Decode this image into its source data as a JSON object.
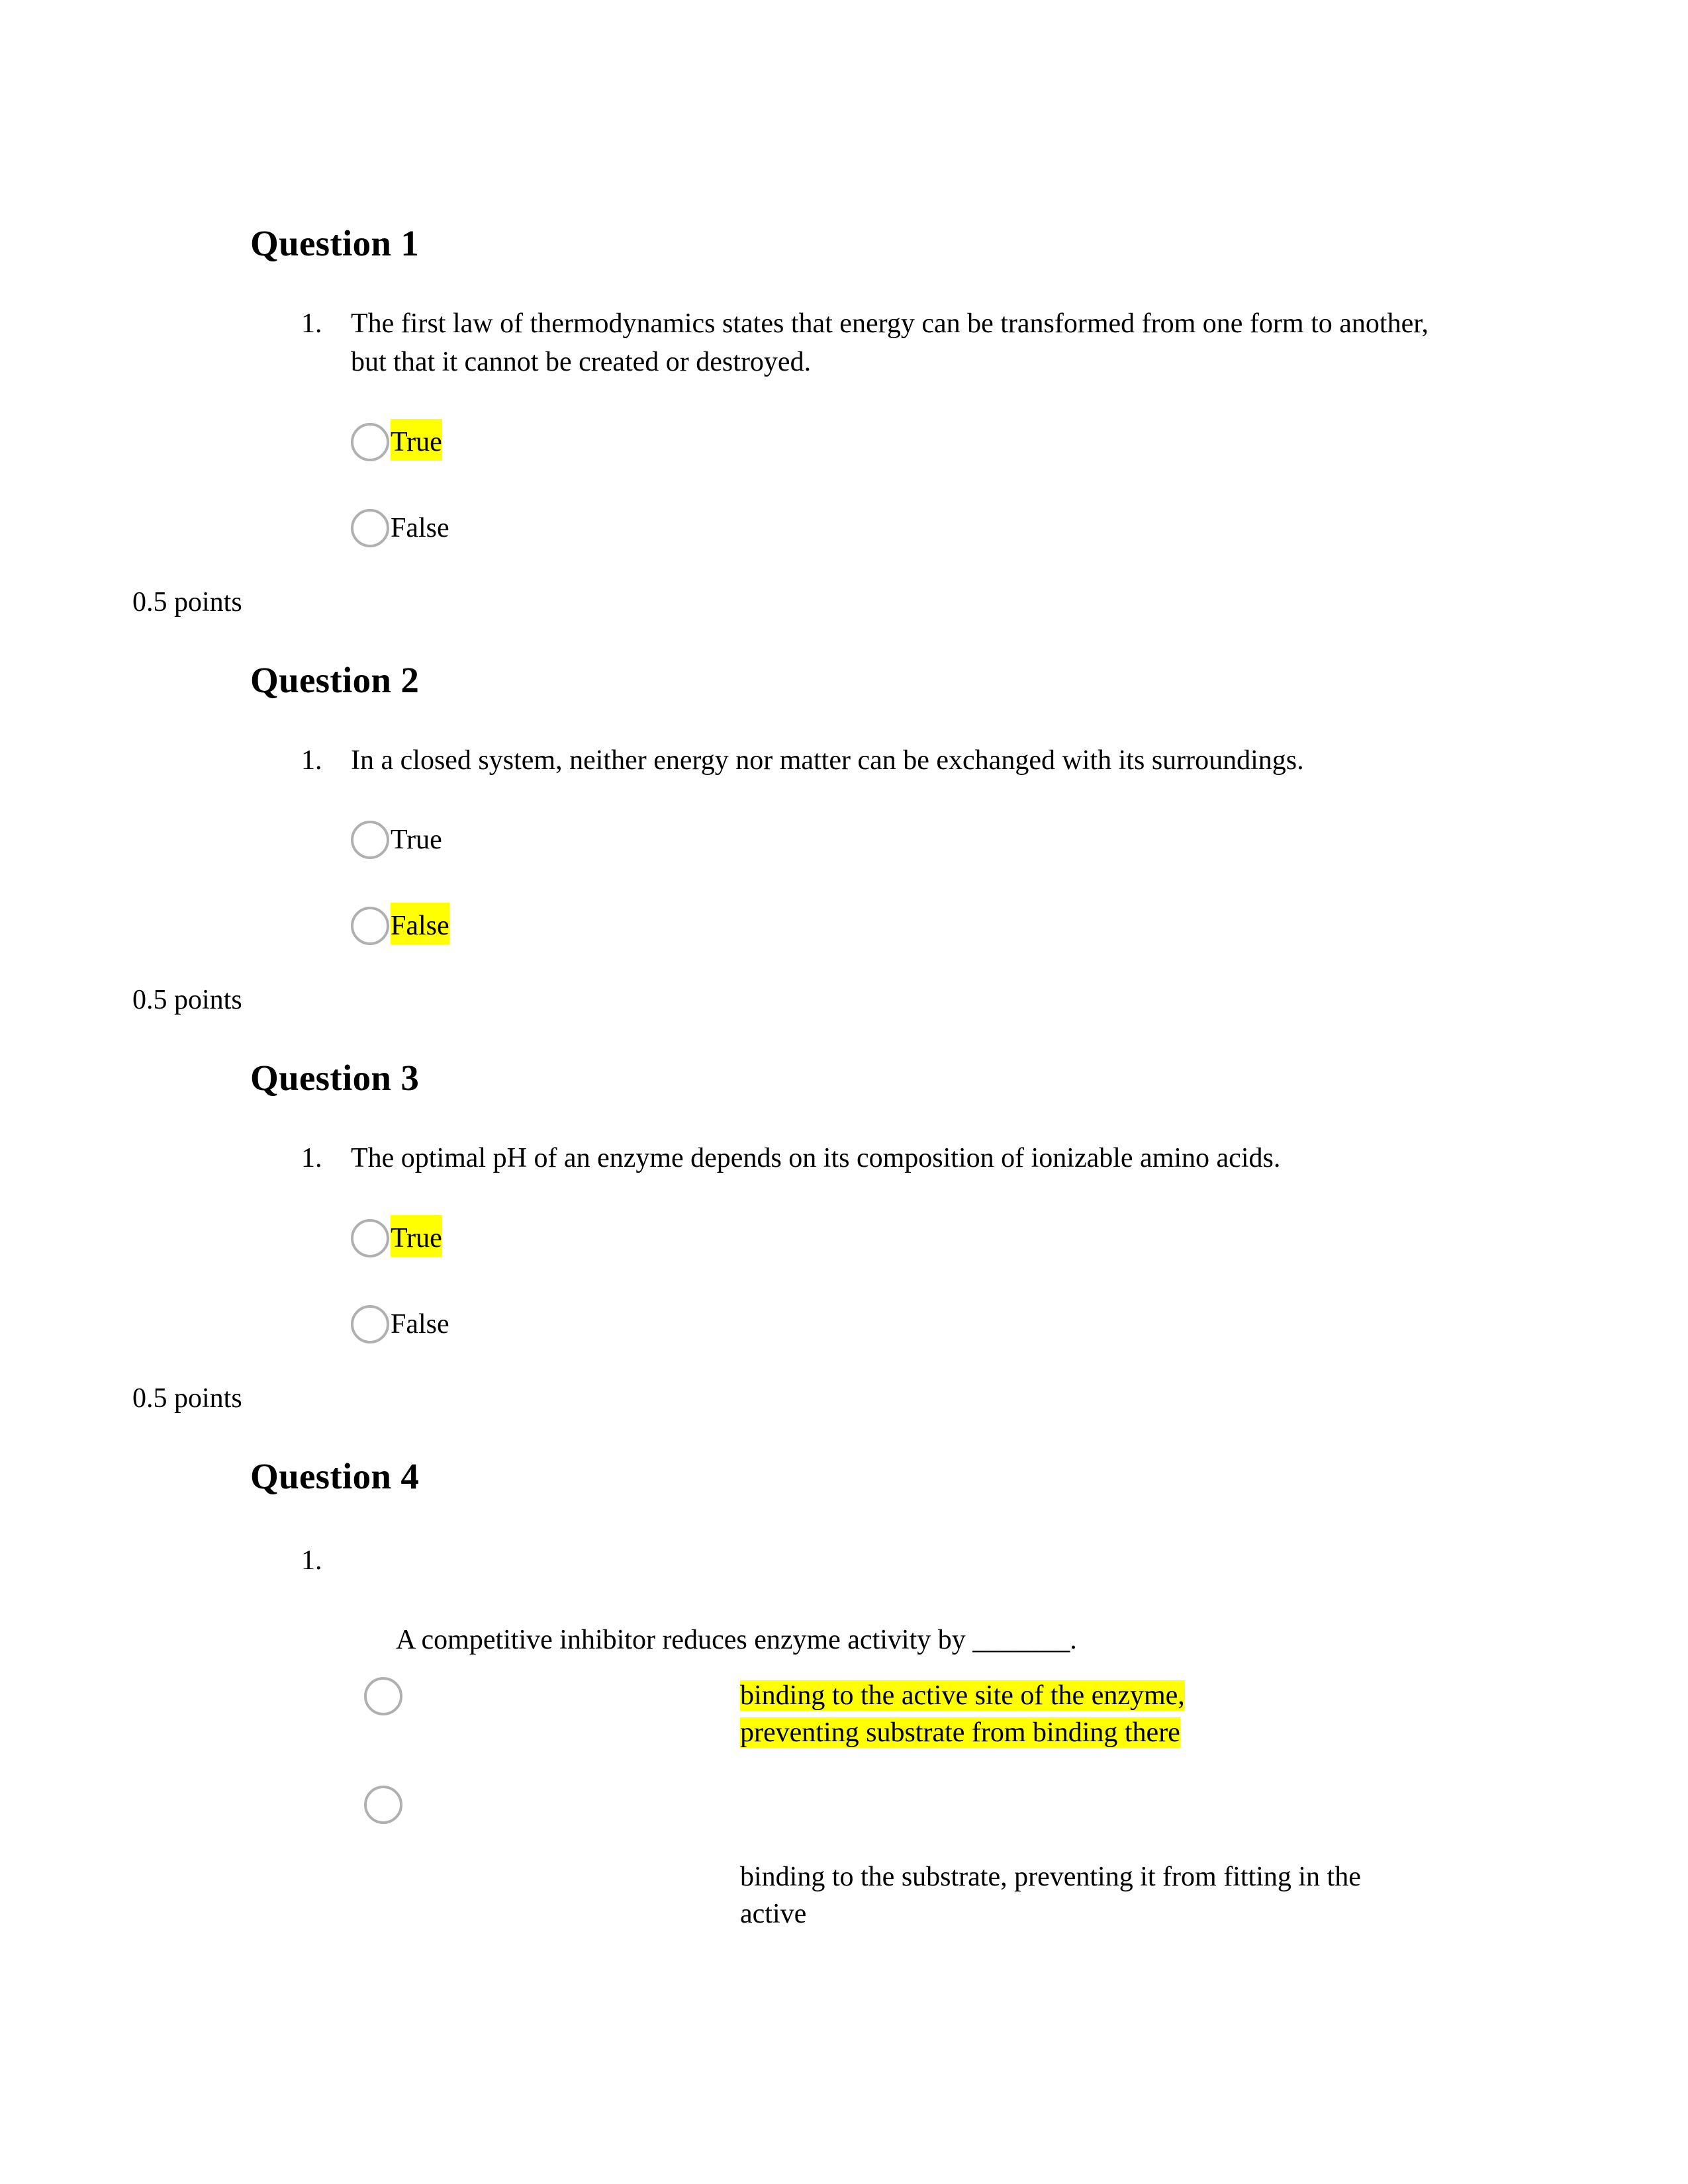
{
  "document": {
    "questions": [
      {
        "heading": "Question 1",
        "marker": "1.",
        "stem": "The first law of thermodynamics states that energy can be transformed from one form to another, but that it cannot be created or destroyed.",
        "options": [
          {
            "label": "True",
            "highlighted": true
          },
          {
            "label": "False",
            "highlighted": false
          }
        ],
        "points": "0.5 points"
      },
      {
        "heading": "Question 2",
        "marker": "1.",
        "stem": "In a closed system, neither energy nor matter can be exchanged with its surroundings.",
        "options": [
          {
            "label": "True",
            "highlighted": false
          },
          {
            "label": "False",
            "highlighted": true
          }
        ],
        "points": "0.5 points"
      },
      {
        "heading": "Question 3",
        "marker": "1.",
        "stem": "The optimal pH of an enzyme depends on its composition of ionizable amino acids.",
        "options": [
          {
            "label": "True",
            "highlighted": true
          },
          {
            "label": "False",
            "highlighted": false
          }
        ],
        "points": "0.5 points"
      },
      {
        "heading": "Question 4",
        "marker": "1.",
        "stem": "A competitive inhibitor reduces enzyme activity by _______.",
        "options": [
          {
            "label": "binding to the active site of the enzyme, preventing substrate from binding there",
            "highlighted": true
          },
          {
            "label": "binding to the substrate, preventing it from fitting in the active",
            "highlighted": false
          }
        ]
      }
    ]
  },
  "colors": {
    "highlight": "#ffff00",
    "text": "#000000",
    "radio_border": "#b0b0b0",
    "page_background": "#ffffff"
  }
}
